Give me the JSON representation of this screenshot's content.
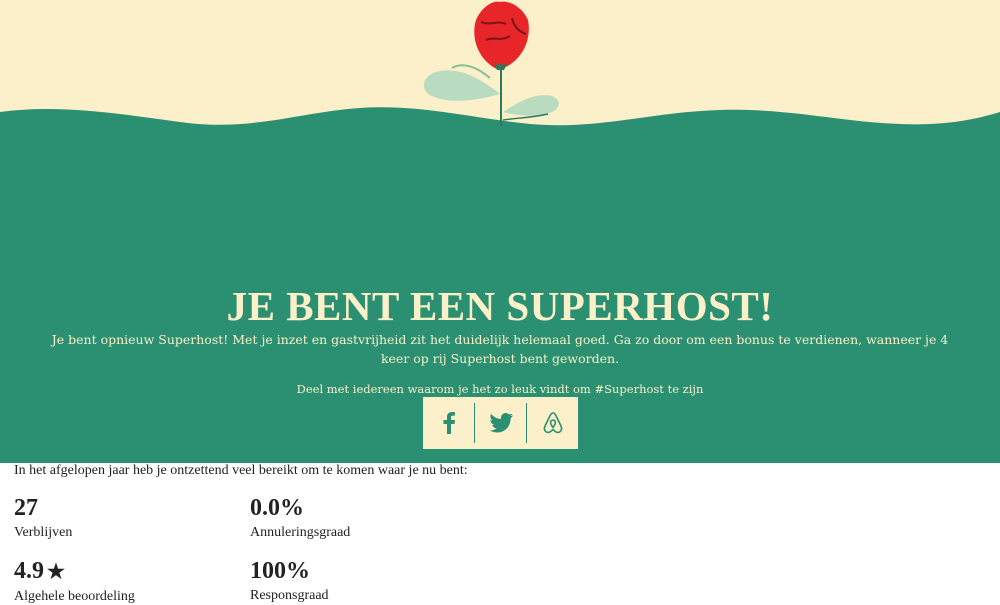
{
  "hero": {
    "title": "JE BENT EEN SUPERHOST!",
    "subtitle": "Je bent opnieuw Superhost! Met je inzet en gastvrijheid zit het duidelijk helemaal goed. Ga zo door om een bonus te verdienen, wanneer je 4 keer op rij Superhost bent geworden.",
    "share_text": "Deel met iedereen waarom je het zo leuk vindt om #Superhost te zijn",
    "share_buttons": [
      {
        "icon": "facebook-icon"
      },
      {
        "icon": "twitter-icon"
      },
      {
        "icon": "airbnb-icon"
      }
    ]
  },
  "stats": {
    "intro": "In het afgelopen jaar heb je ontzettend veel bereikt om te komen waar je nu bent:",
    "items": [
      {
        "value": "27",
        "label": "Verblijven"
      },
      {
        "value": "0.0%",
        "label": "Annuleringsgraad"
      },
      {
        "value": "4.9",
        "star": "★",
        "label": "Algehele beoordeling"
      },
      {
        "value": "100%",
        "label": "Responsgraad"
      }
    ]
  },
  "colors": {
    "cream": "#fbf0c9",
    "green": "#2a9071",
    "rose": "#e8262a"
  }
}
